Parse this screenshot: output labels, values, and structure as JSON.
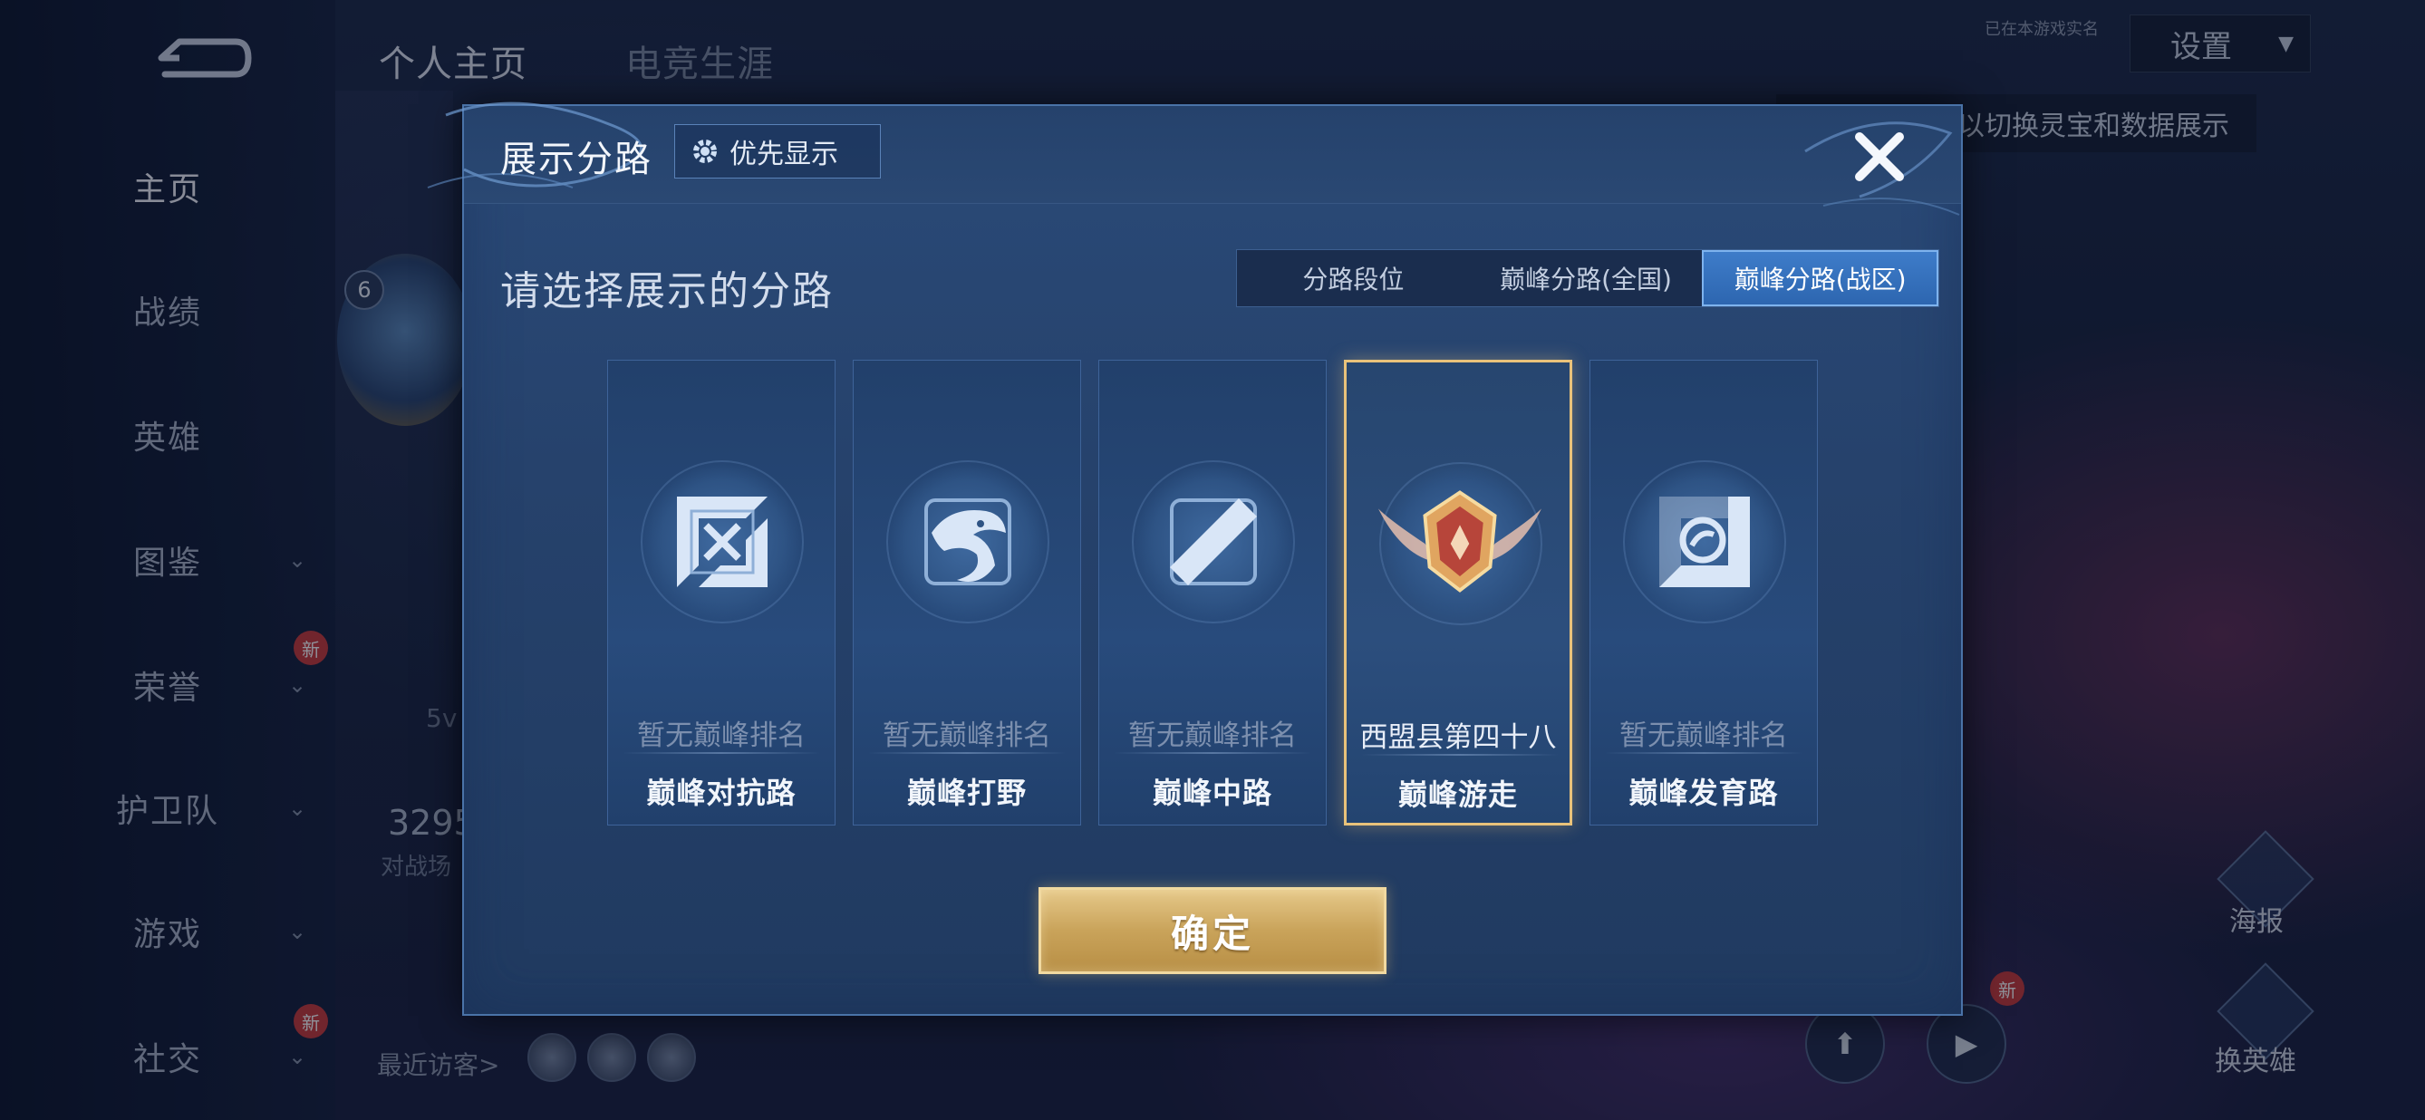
{
  "top_tabs": {
    "profile": "个人主页",
    "esports": "电竞生涯"
  },
  "top_right": {
    "settings_label": "设置",
    "status_small": "已在本游戏实名",
    "tip": "以切换灵宝和数据展示"
  },
  "sidebar": {
    "items": [
      {
        "label": "主页",
        "active": true,
        "has_chevron": false,
        "new": false
      },
      {
        "label": "战绩",
        "active": false,
        "has_chevron": false,
        "new": false
      },
      {
        "label": "英雄",
        "active": false,
        "has_chevron": false,
        "new": false
      },
      {
        "label": "图鉴",
        "active": false,
        "has_chevron": true,
        "new": false
      },
      {
        "label": "荣誉",
        "active": false,
        "has_chevron": true,
        "new": true
      },
      {
        "label": "护卫队",
        "active": false,
        "has_chevron": true,
        "new": false
      },
      {
        "label": "游戏",
        "active": false,
        "has_chevron": true,
        "new": false
      },
      {
        "label": "社交",
        "active": false,
        "has_chevron": true,
        "new": true
      }
    ],
    "new_badge": "新"
  },
  "profile_bg": {
    "level": "6",
    "mode_text": "5v",
    "stat_number": "3295",
    "stat_label": "对战场",
    "recent_visitors": "最近访客>"
  },
  "right_side": {
    "poster_label": "海报",
    "swap_hero_label": "换英雄",
    "new_badge": "新"
  },
  "modal": {
    "title": "展示分路",
    "priority_button": "优先显示",
    "section_title": "请选择展示的分路",
    "segments": [
      {
        "label": "分路段位",
        "active": false
      },
      {
        "label": "巅峰分路(全国)",
        "active": false
      },
      {
        "label": "巅峰分路(战区)",
        "active": true
      }
    ],
    "cards": [
      {
        "rank": "暂无巅峰排名",
        "lane": "巅峰对抗路",
        "icon": "clash-lane-icon",
        "selected": false
      },
      {
        "rank": "暂无巅峰排名",
        "lane": "巅峰打野",
        "icon": "jungle-dragon-icon",
        "selected": false
      },
      {
        "rank": "暂无巅峰排名",
        "lane": "巅峰中路",
        "icon": "mid-lane-icon",
        "selected": false
      },
      {
        "rank": "西盟县第四十八",
        "lane": "巅峰游走",
        "icon": "roam-winged-badge-icon",
        "selected": true
      },
      {
        "rank": "暂无巅峰排名",
        "lane": "巅峰发育路",
        "icon": "farm-lane-icon",
        "selected": false
      }
    ],
    "confirm_label": "确定"
  },
  "colors": {
    "accent_gold": "#e9c27a",
    "active_tab": "#3e7cc9",
    "modal_bg": "#26426c"
  }
}
